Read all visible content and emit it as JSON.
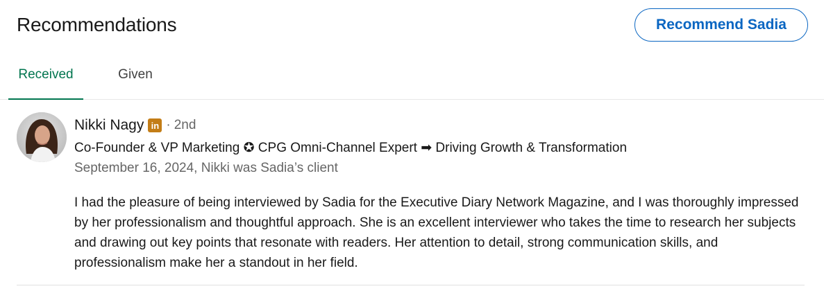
{
  "section": {
    "title": "Recommendations",
    "action_label": "Recommend Sadia"
  },
  "tabs": [
    {
      "label": "Received",
      "active": true
    },
    {
      "label": "Given",
      "active": false
    }
  ],
  "recommendation": {
    "name": "Nikki Nagy",
    "badge_icon": "linkedin-premium-icon",
    "badge_text": "in",
    "separator": "·",
    "degree": "2nd",
    "headline": "Co-Founder & VP Marketing ✪ CPG Omni-Channel Expert ➡ Driving Growth & Transformation",
    "meta": "September 16, 2024, Nikki was Sadia’s client",
    "text": "I had the pleasure of being interviewed by Sadia for the Executive Diary Network Magazine, and I was thoroughly impressed by her professionalism and thoughtful approach. She is an excellent interviewer who takes the time to research her subjects and drawing out key points that resonate with readers. Her attention to detail, strong communication skills, and professionalism make her a standout in her field."
  },
  "colors": {
    "accent": "#0a66c2",
    "tab_active": "#01754f",
    "badge": "#c37d16"
  }
}
